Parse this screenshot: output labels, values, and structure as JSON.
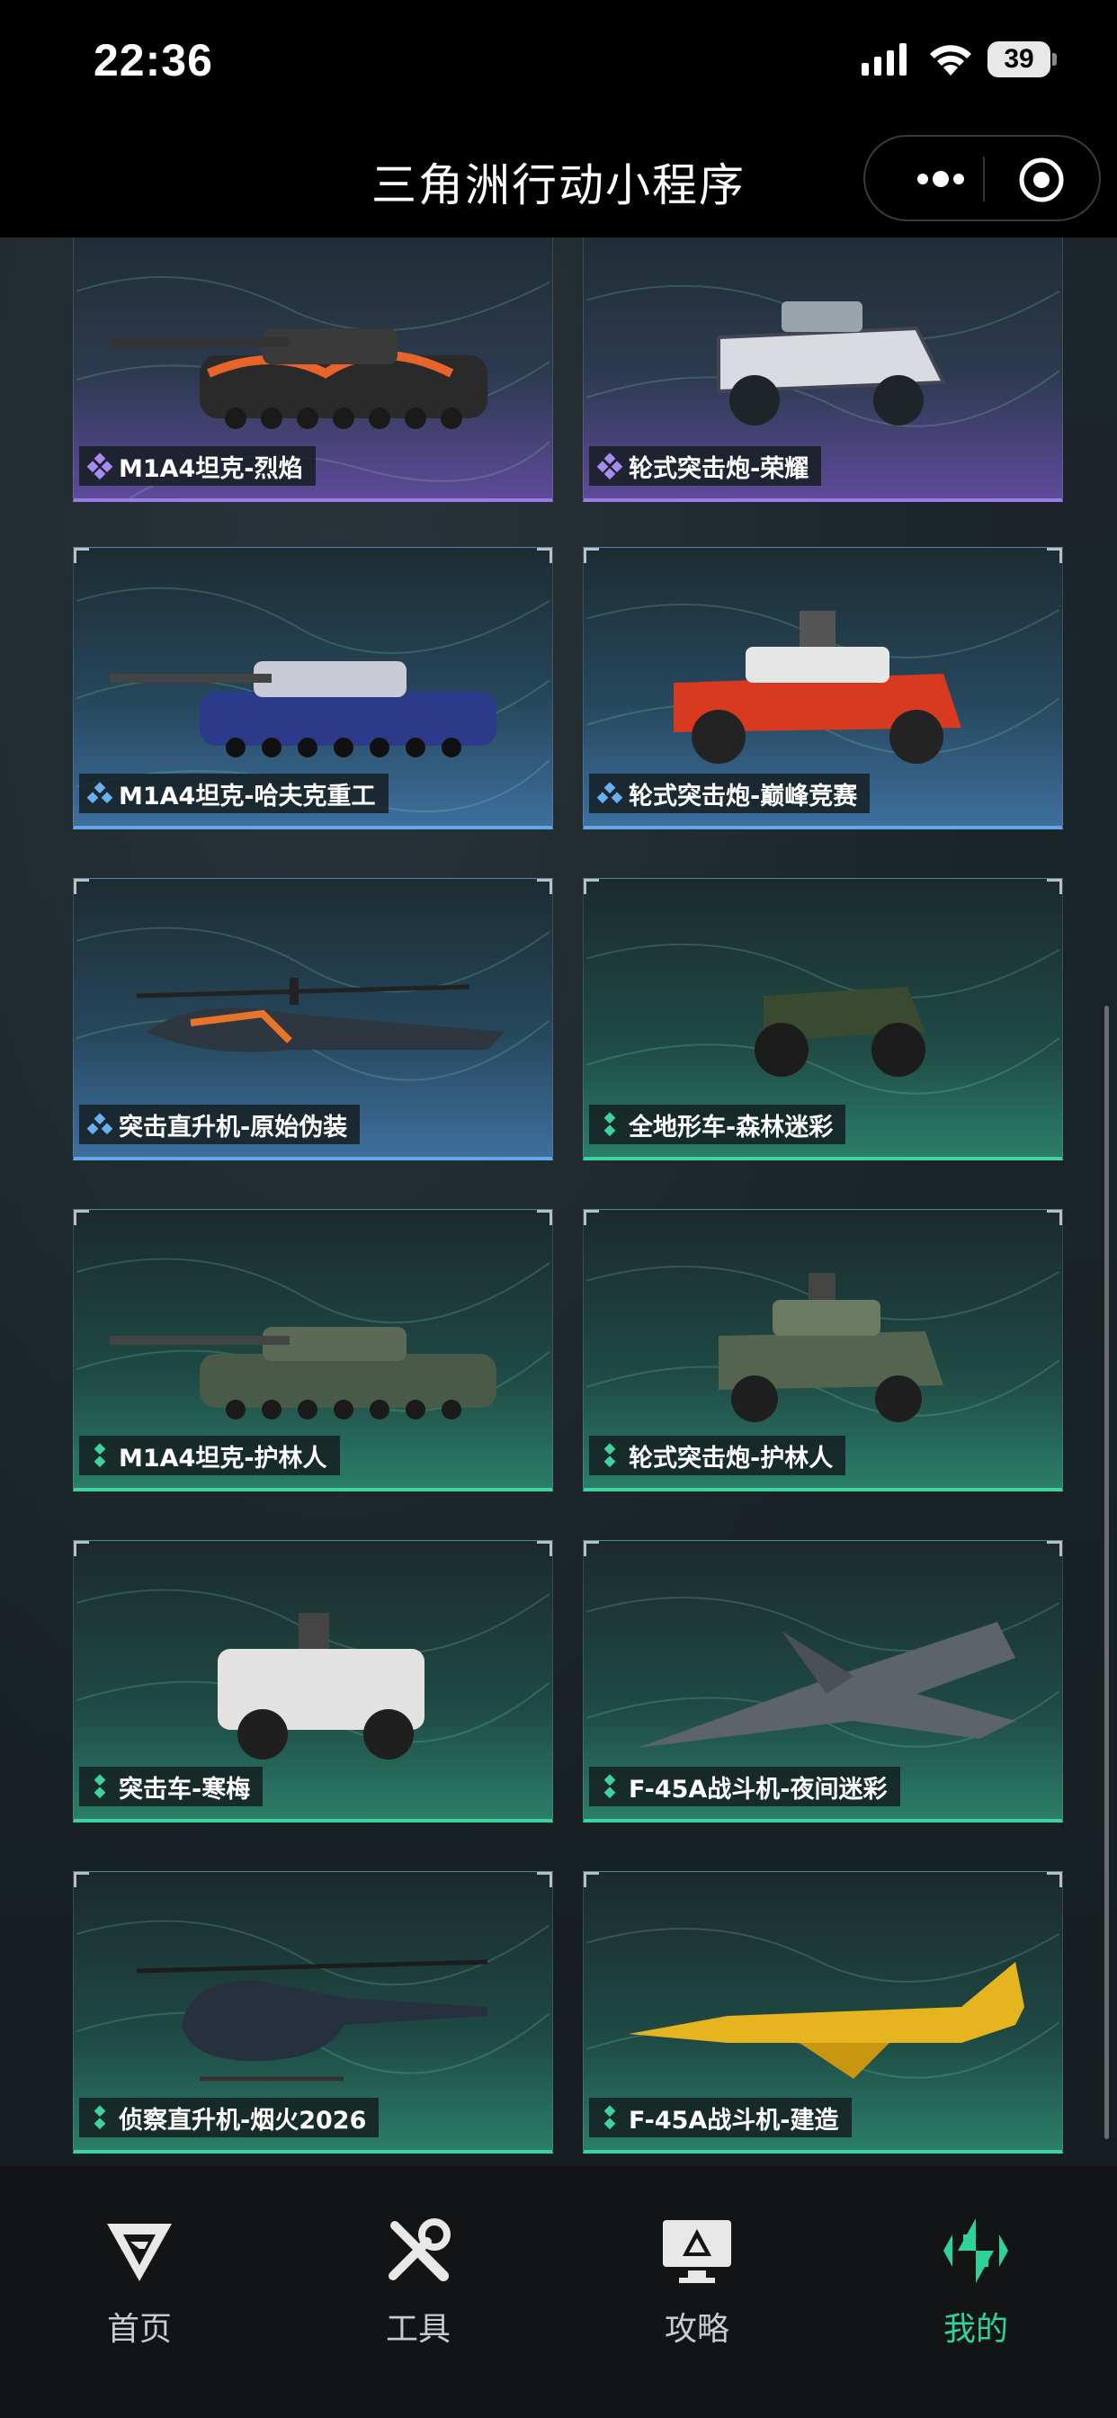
{
  "status_bar": {
    "time": "22:36",
    "battery": "39"
  },
  "nav": {
    "title": "三角洲行动小程序"
  },
  "colors": {
    "epic": "#9b7be6",
    "rare": "#66a6e6",
    "uncommon": "#3fd29e",
    "active_tab": "#2fd39a"
  },
  "vehicles": [
    {
      "name": "M1A4坦克-烈焰",
      "rarity": "epic",
      "icon": "tank-flame"
    },
    {
      "name": "轮式突击炮-荣耀",
      "rarity": "epic",
      "icon": "armored-car-white"
    },
    {
      "name": "M1A4坦克-哈夫克重工",
      "rarity": "rare",
      "icon": "tank-blue"
    },
    {
      "name": "轮式突击炮-巅峰竞赛",
      "rarity": "rare",
      "icon": "armored-car-red"
    },
    {
      "name": "突击直升机-原始伪装",
      "rarity": "rare",
      "icon": "attack-helicopter"
    },
    {
      "name": "全地形车-森林迷彩",
      "rarity": "uncommon",
      "icon": "atv"
    },
    {
      "name": "M1A4坦克-护林人",
      "rarity": "uncommon",
      "icon": "tank-camo"
    },
    {
      "name": "轮式突击炮-护林人",
      "rarity": "uncommon",
      "icon": "armored-car-camo"
    },
    {
      "name": "突击车-寒梅",
      "rarity": "uncommon",
      "icon": "assault-vehicle"
    },
    {
      "name": "F-45A战斗机-夜间迷彩",
      "rarity": "uncommon",
      "icon": "fighter-jet-camo"
    },
    {
      "name": "侦察直升机-烟火2026",
      "rarity": "uncommon",
      "icon": "scout-helicopter"
    },
    {
      "name": "F-45A战斗机-建造",
      "rarity": "uncommon",
      "icon": "fighter-jet-yellow"
    }
  ],
  "tabs": [
    {
      "label": "首页",
      "icon": "home-logo-icon",
      "active": false
    },
    {
      "label": "工具",
      "icon": "tools-icon",
      "active": false
    },
    {
      "label": "攻略",
      "icon": "guide-monitor-icon",
      "active": false
    },
    {
      "label": "我的",
      "icon": "profile-logo-icon",
      "active": true
    }
  ]
}
